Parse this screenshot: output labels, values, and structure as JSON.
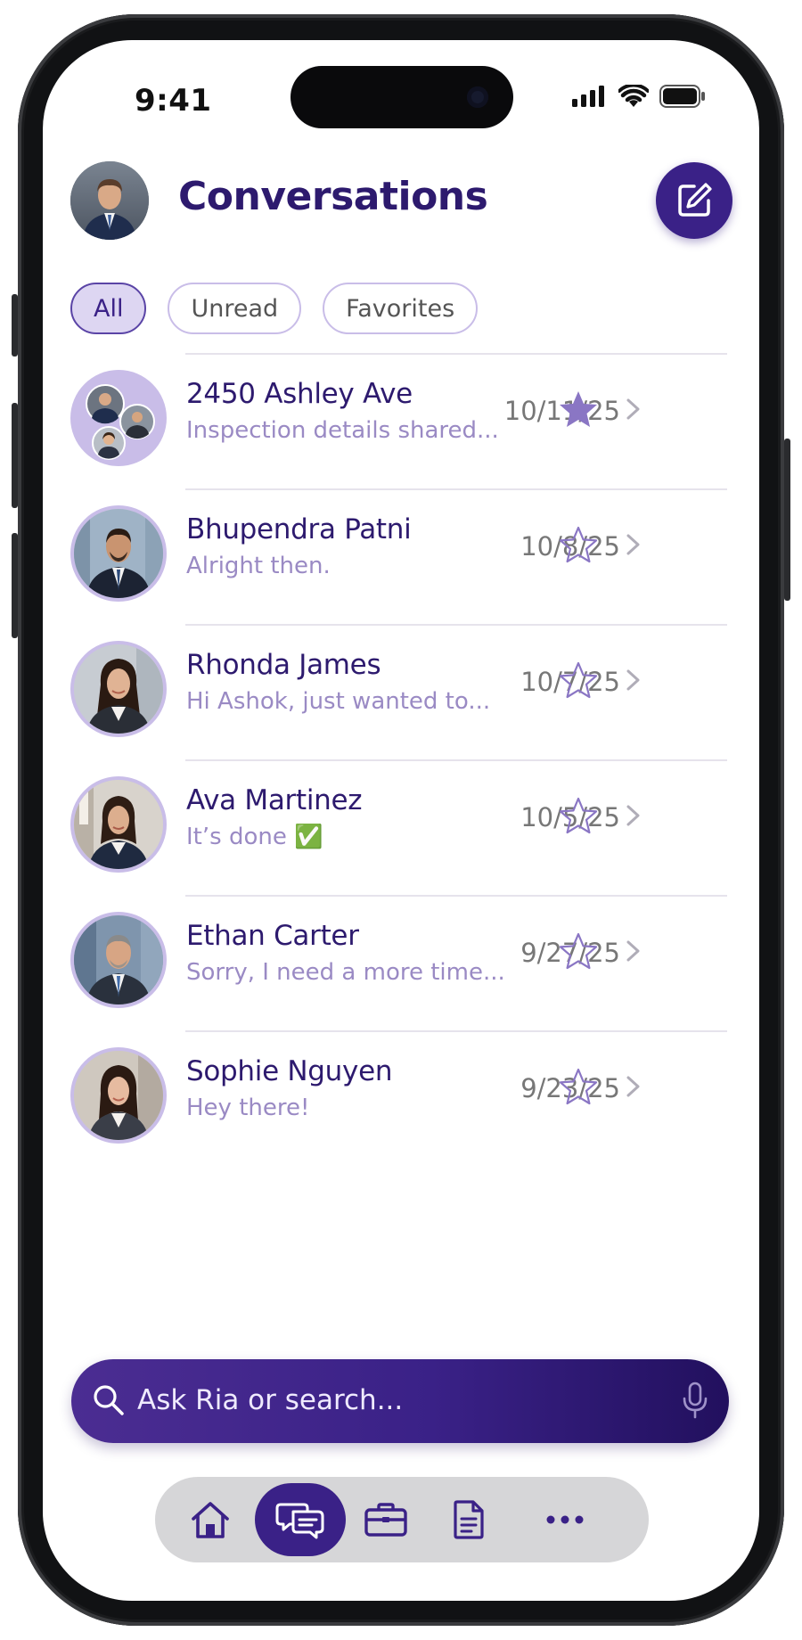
{
  "status_bar": {
    "time": "9:41"
  },
  "header": {
    "title": "Conversations",
    "compose_icon": "compose-icon"
  },
  "filters": [
    {
      "label": "All",
      "active": true
    },
    {
      "label": "Unread",
      "active": false
    },
    {
      "label": "Favorites",
      "active": false
    }
  ],
  "conversations": [
    {
      "name": "2450 Ashley Ave",
      "preview": "Inspection details shared...",
      "date": "10/11/25",
      "favorite": true,
      "group": true
    },
    {
      "name": "Bhupendra Patni",
      "preview": "Alright then.",
      "date": "10/8/25",
      "favorite": false
    },
    {
      "name": "Rhonda James",
      "preview": "Hi Ashok, just wanted to...",
      "date": "10/7/25",
      "favorite": false
    },
    {
      "name": "Ava Martinez",
      "preview": "It’s done ✅",
      "date": "10/5/25",
      "favorite": false
    },
    {
      "name": "Ethan Carter",
      "preview": "Sorry, I need a more time...",
      "date": "9/27/25",
      "favorite": false
    },
    {
      "name": "Sophie Nguyen",
      "preview": "Hey there!",
      "date": "9/23/25",
      "favorite": false
    }
  ],
  "search": {
    "placeholder": "Ask Ria or search..."
  },
  "tabbar": {
    "items": [
      {
        "icon": "home-icon",
        "active": false
      },
      {
        "icon": "chat-icon",
        "active": true
      },
      {
        "icon": "briefcase-icon",
        "active": false
      },
      {
        "icon": "document-icon",
        "active": false
      },
      {
        "icon": "more-icon",
        "active": false
      }
    ]
  },
  "colors": {
    "brand": "#3a2187",
    "title": "#2d1a6e",
    "preview": "#9a8ac4",
    "chip_border": "#c9bde8",
    "star_filled": "#8a76c4"
  }
}
